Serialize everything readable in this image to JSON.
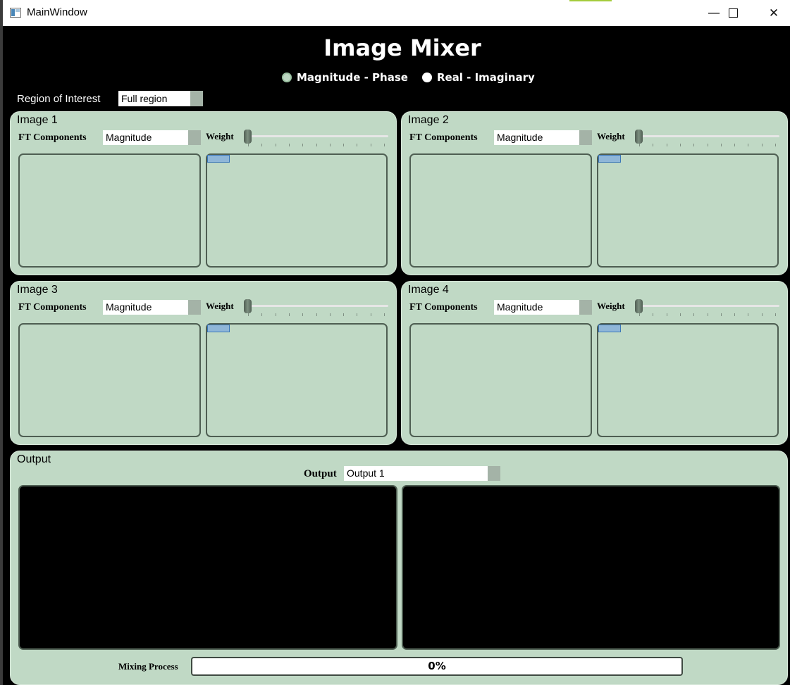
{
  "window": {
    "title": "MainWindow",
    "minimize_glyph": "—",
    "maximize_glyph": "☐",
    "close_glyph": "✕"
  },
  "app": {
    "title": "Image Mixer",
    "modes": [
      {
        "label": "Magnitude - Phase",
        "checked": true
      },
      {
        "label": "Real - Imaginary",
        "checked": false
      }
    ],
    "region": {
      "label": "Region of Interest",
      "value": "Full region"
    }
  },
  "images": [
    {
      "title": "Image 1",
      "ft_label": "FT Components",
      "ft_value": "Magnitude",
      "weight_label": "Weight",
      "weight": 0
    },
    {
      "title": "Image 2",
      "ft_label": "FT Components",
      "ft_value": "Magnitude",
      "weight_label": "Weight",
      "weight": 0
    },
    {
      "title": "Image 3",
      "ft_label": "FT Components",
      "ft_value": "Magnitude",
      "weight_label": "Weight",
      "weight": 0
    },
    {
      "title": "Image 4",
      "ft_label": "FT Components",
      "ft_value": "Magnitude",
      "weight_label": "Weight",
      "weight": 0
    }
  ],
  "output": {
    "title": "Output",
    "selector_label": "Output",
    "selector_value": "Output 1",
    "mixing_label": "Mixing Process",
    "progress_text": "0%",
    "progress": 0
  },
  "colors": {
    "panel_bg": "#c0d9c5",
    "window_bg": "#000000",
    "roi_selection": "#8fb6d8"
  }
}
